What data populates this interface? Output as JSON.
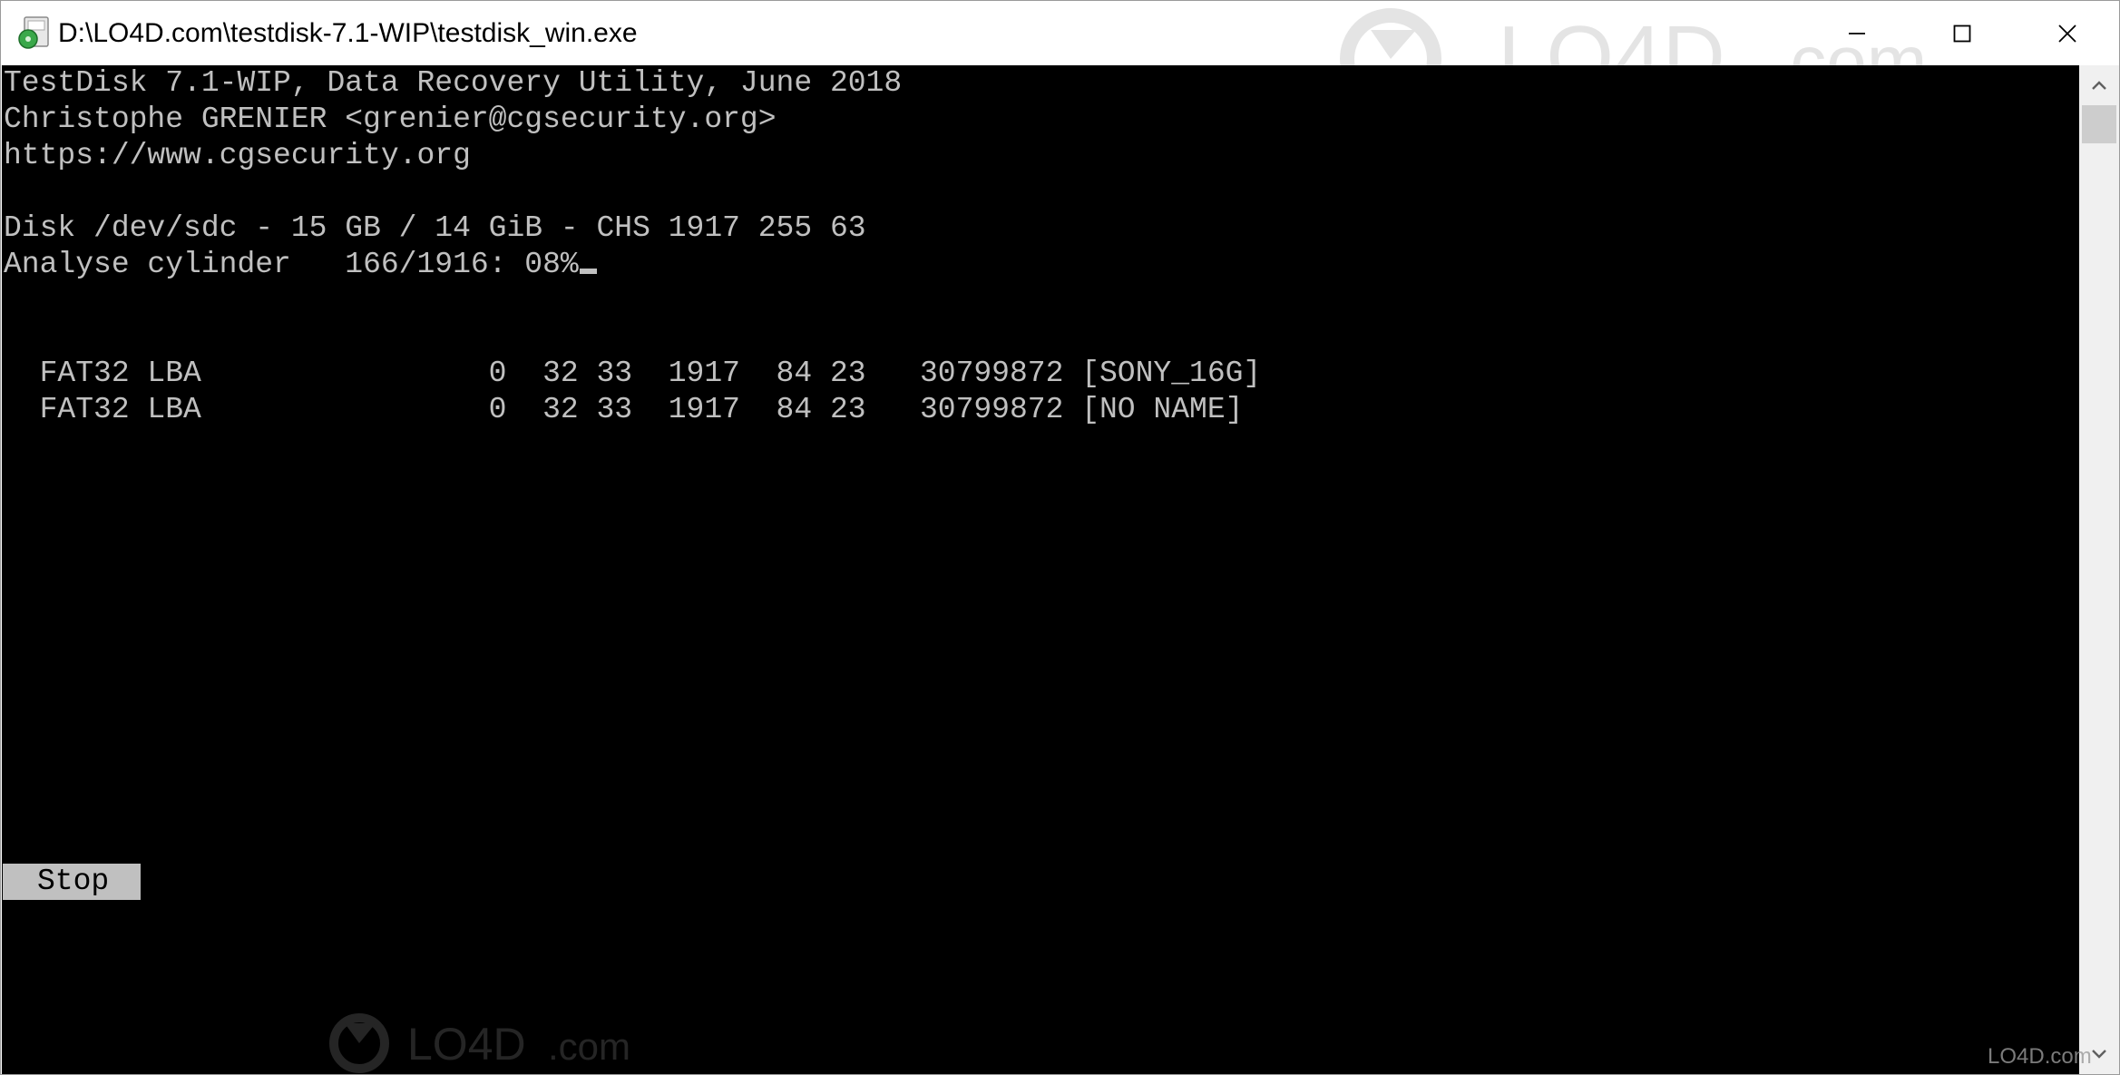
{
  "window": {
    "title": "D:\\LO4D.com\\testdisk-7.1-WIP\\testdisk_win.exe",
    "app_icon": "testdisk-app-icon",
    "minimize_icon": "minimize-icon",
    "maximize_icon": "maximize-icon",
    "close_icon": "close-icon"
  },
  "console": {
    "header_lines": [
      "TestDisk 7.1-WIP, Data Recovery Utility, June 2018",
      "Christophe GRENIER <grenier@cgsecurity.org>",
      "https://www.cgsecurity.org"
    ],
    "disk_line": "Disk /dev/sdc - 15 GB / 14 GiB - CHS 1917 255 63",
    "analyse_line": "Analyse cylinder   166/1916: 08%",
    "partitions": [
      "  FAT32 LBA                0  32 33  1917  84 23   30799872 [SONY_16G]",
      "  FAT32 LBA                0  32 33  1917  84 23   30799872 [NO NAME]"
    ],
    "stop_label": "Stop",
    "background_color": "#000000",
    "text_color": "#c0c0c0"
  },
  "watermark": {
    "text": "LO4D.com"
  }
}
